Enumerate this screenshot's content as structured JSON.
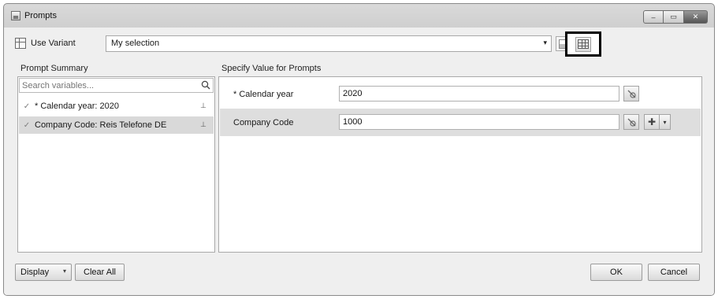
{
  "window": {
    "title": "Prompts",
    "controls": {
      "minimize": "–",
      "maximize": "▭",
      "close": "✕"
    }
  },
  "variant": {
    "label": "Use Variant",
    "selected_value": "My selection"
  },
  "prompt_summary": {
    "heading": "Prompt Summary",
    "search_placeholder": "Search variables...",
    "items": [
      {
        "label": "* Calendar year: 2020",
        "selected": false
      },
      {
        "label": "Company Code: Reis Telefone DE",
        "selected": true
      }
    ]
  },
  "specify_values": {
    "heading": "Specify Value for Prompts",
    "rows": [
      {
        "label": "* Calendar year",
        "value": "2020"
      },
      {
        "label": "Company Code",
        "value": "1000"
      }
    ]
  },
  "footer": {
    "display_label": "Display",
    "clear_all_label": "Clear All",
    "ok_label": "OK",
    "cancel_label": "Cancel"
  },
  "icons": {
    "check": "✓",
    "pin": "⊥",
    "caret": "▾",
    "add": "✚",
    "variables": "⎘"
  }
}
